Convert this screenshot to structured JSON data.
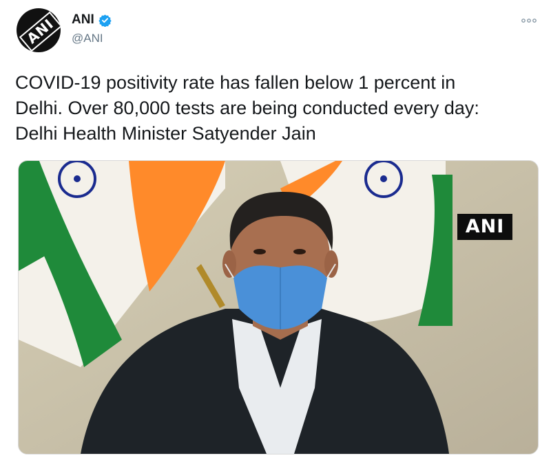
{
  "author": {
    "display_name": "ANI",
    "handle": "@ANI",
    "avatar_icon": "ani-logo-avatar",
    "avatar_text": "ANI",
    "verified": true,
    "verified_color": "#1da1f2"
  },
  "tweet": {
    "text": "COVID-19 positivity rate has fallen below 1 percent in\nDelhi. Over 80,000 tests are being conducted every day:\nDelhi Health Minister Satyender Jain"
  },
  "media": {
    "watermark": "ANI"
  },
  "colors": {
    "saffron": "#ff8a2a",
    "green": "#1f8a3a",
    "chakra": "#1a2b8f",
    "mask": "#4a90d8",
    "jacket": "#1e2328"
  }
}
